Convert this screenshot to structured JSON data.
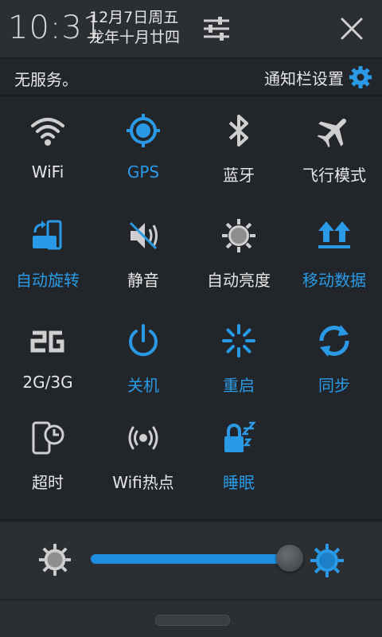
{
  "header": {
    "time": "10:31",
    "date_line1": "12月7日周五",
    "date_line2": "龙年十月廿四"
  },
  "status": {
    "service": "无服务。",
    "notification_settings": "通知栏设置"
  },
  "colors": {
    "accent": "#2a9ae6",
    "inactive": "#cfcfcf",
    "background": "#22262b"
  },
  "toggles": [
    {
      "label": "WiFi",
      "icon": "wifi-icon",
      "active": false
    },
    {
      "label": "GPS",
      "icon": "gps-icon",
      "active": true
    },
    {
      "label": "蓝牙",
      "icon": "bluetooth-icon",
      "active": false
    },
    {
      "label": "飞行模式",
      "icon": "airplane-icon",
      "active": false
    },
    {
      "label": "自动旋转",
      "icon": "rotate-icon",
      "active": true
    },
    {
      "label": "静音",
      "icon": "mute-icon",
      "active": false
    },
    {
      "label": "自动亮度",
      "icon": "auto-brightness-icon",
      "active": false
    },
    {
      "label": "移动数据",
      "icon": "mobile-data-icon",
      "active": true
    },
    {
      "label": "2G/3G",
      "icon": "network-2g-icon",
      "active": false
    },
    {
      "label": "关机",
      "icon": "power-icon",
      "active": true
    },
    {
      "label": "重启",
      "icon": "restart-icon",
      "active": true
    },
    {
      "label": "同步",
      "icon": "sync-icon",
      "active": true
    },
    {
      "label": "超时",
      "icon": "timeout-icon",
      "active": false
    },
    {
      "label": "Wifi热点",
      "icon": "hotspot-icon",
      "active": false
    },
    {
      "label": "睡眠",
      "icon": "sleep-icon",
      "active": true
    }
  ],
  "brightness": {
    "level": 0.93
  }
}
